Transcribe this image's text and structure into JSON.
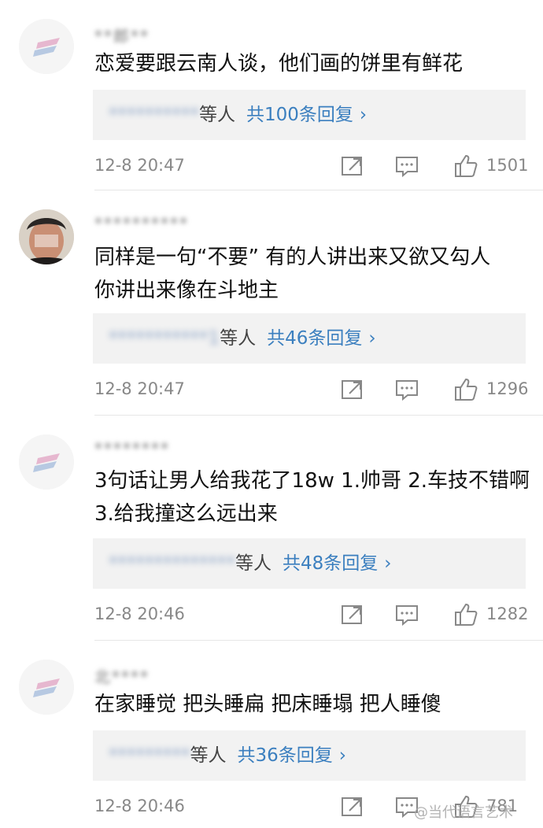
{
  "comments": [
    {
      "username": "**郎**",
      "text": "恋爱要跟云南人谈，他们画的饼里有鲜花",
      "replies_names": "**********",
      "replies_suffix": "等人",
      "replies_count": "共100条回复",
      "time": "12-8 20:47",
      "likes": "1501",
      "avatar": "logo-avatar"
    },
    {
      "username": "**********",
      "text": "同样是一句“不要” 有的人讲出来又欲又勾人\n你讲出来像在斗地主",
      "replies_names": "***********1",
      "replies_suffix": "等人",
      "replies_count": "共46条回复",
      "time": "12-8 20:47",
      "likes": "1296",
      "avatar": "photo-avatar"
    },
    {
      "username": "********",
      "text": "3句话让男人给我花了18w 1.帅哥 2.车技不错啊 3.给我撞这么远出来",
      "replies_names": "**************",
      "replies_suffix": "等人",
      "replies_count": "共48条回复",
      "time": "12-8 20:46",
      "likes": "1282",
      "avatar": "logo-avatar"
    },
    {
      "username": "北****",
      "text": "在家睡觉  把头睡扁  把床睡塌  把人睡傻",
      "replies_names": "*********",
      "replies_suffix": "等人",
      "replies_count": "共36条回复",
      "time": "12-8 20:46",
      "likes": "781",
      "avatar": "logo-avatar"
    }
  ],
  "watermark": "@当代语言艺术",
  "icons": {
    "share": "share-icon",
    "comment": "comment-icon",
    "like": "thumbs-up-icon",
    "chevron": "chevron-right-icon"
  },
  "chevron_glyph": "›",
  "colors": {
    "link": "#3b7fbf",
    "meta": "#888888",
    "reply_bg": "#f2f2f2"
  }
}
